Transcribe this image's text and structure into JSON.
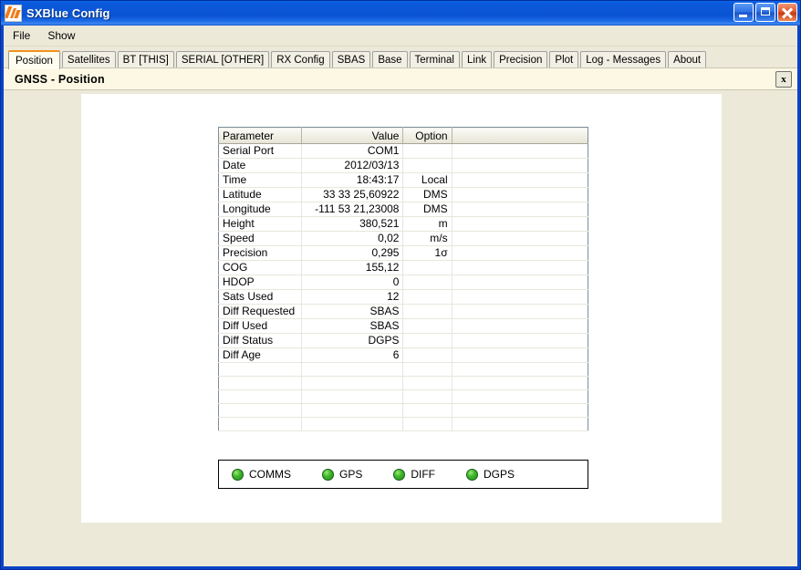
{
  "window": {
    "title": "SXBlue Config",
    "icon": "app-logo-icon",
    "buttons": {
      "minimize": "minimize-button",
      "maximize": "maximize-button",
      "close": "close-button"
    }
  },
  "menubar": {
    "items": [
      {
        "label": "File"
      },
      {
        "label": "Show"
      }
    ]
  },
  "tabs": [
    {
      "label": "Position",
      "active": true
    },
    {
      "label": "Satellites",
      "active": false
    },
    {
      "label": "BT [THIS]",
      "active": false
    },
    {
      "label": "SERIAL [OTHER]",
      "active": false
    },
    {
      "label": "RX Config",
      "active": false
    },
    {
      "label": "SBAS",
      "active": false
    },
    {
      "label": "Base",
      "active": false
    },
    {
      "label": "Terminal",
      "active": false
    },
    {
      "label": "Link",
      "active": false
    },
    {
      "label": "Precision",
      "active": false
    },
    {
      "label": "Plot",
      "active": false
    },
    {
      "label": "Log - Messages",
      "active": false
    },
    {
      "label": "About",
      "active": false
    }
  ],
  "page_header": {
    "title": "GNSS - Position",
    "close_label": "x"
  },
  "table": {
    "columns": [
      "Parameter",
      "Value",
      "Option",
      ""
    ],
    "rows": [
      {
        "parameter": "Serial Port",
        "value": "COM1",
        "option": ""
      },
      {
        "parameter": "Date",
        "value": "2012/03/13",
        "option": ""
      },
      {
        "parameter": "Time",
        "value": "18:43:17",
        "option": "Local"
      },
      {
        "parameter": "Latitude",
        "value": "33 33 25,60922",
        "option": "DMS"
      },
      {
        "parameter": "Longitude",
        "value": "-111 53 21,23008",
        "option": "DMS"
      },
      {
        "parameter": "Height",
        "value": "380,521",
        "option": "m"
      },
      {
        "parameter": "Speed",
        "value": "0,02",
        "option": "m/s"
      },
      {
        "parameter": "Precision",
        "value": "0,295",
        "option": "1σ"
      },
      {
        "parameter": "COG",
        "value": "155,12",
        "option": ""
      },
      {
        "parameter": "HDOP",
        "value": "0",
        "option": ""
      },
      {
        "parameter": "Sats Used",
        "value": "12",
        "option": ""
      },
      {
        "parameter": "Diff Requested",
        "value": "SBAS",
        "option": ""
      },
      {
        "parameter": "Diff Used",
        "value": "SBAS",
        "option": ""
      },
      {
        "parameter": "Diff Status",
        "value": "DGPS",
        "option": ""
      },
      {
        "parameter": "Diff Age",
        "value": "6",
        "option": ""
      },
      {
        "parameter": "",
        "value": "",
        "option": ""
      },
      {
        "parameter": "",
        "value": "",
        "option": ""
      },
      {
        "parameter": "",
        "value": "",
        "option": ""
      },
      {
        "parameter": "",
        "value": "",
        "option": ""
      },
      {
        "parameter": "",
        "value": "",
        "option": ""
      }
    ]
  },
  "status_panel": {
    "indicators": [
      {
        "label": "COMMS",
        "color": "#3eb52b",
        "state": "on"
      },
      {
        "label": "GPS",
        "color": "#3eb52b",
        "state": "on"
      },
      {
        "label": "DIFF",
        "color": "#3eb52b",
        "state": "on"
      },
      {
        "label": "DGPS",
        "color": "#3eb52b",
        "state": "on"
      }
    ]
  },
  "colors": {
    "titlebar_blue": "#0b56d6",
    "client_beige": "#ece9d8",
    "header_cream": "#fdf8e3",
    "active_tab_accent": "#f0921e",
    "panel_white": "#ffffff",
    "led_green": "#3eb52b"
  }
}
